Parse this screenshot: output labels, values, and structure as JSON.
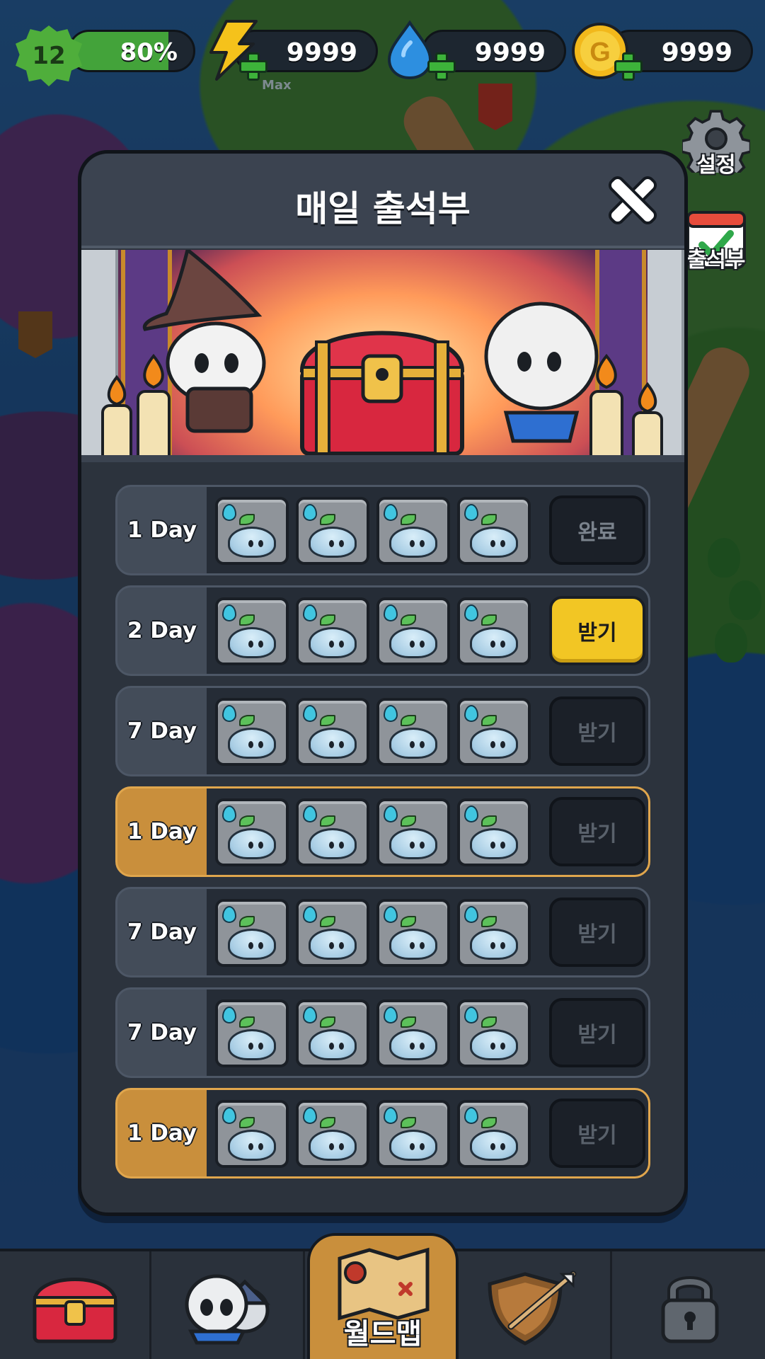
{
  "top_bar": {
    "level": "12",
    "xp_percent_text": "80%",
    "xp_fraction": 0.8,
    "energy": {
      "value": "9999",
      "sub_label": "Max",
      "icon": "lightning-icon"
    },
    "water": {
      "value": "9999",
      "icon": "water-drop-icon"
    },
    "gold": {
      "value": "9999",
      "icon": "gold-coin-icon"
    }
  },
  "side_menu": {
    "settings_label": "설정",
    "attendance_label": "출석부"
  },
  "modal": {
    "title": "매일 출석부",
    "rows": [
      {
        "day": "1 Day",
        "style": "normal",
        "button": "완료",
        "state": "done"
      },
      {
        "day": "2 Day",
        "style": "normal",
        "button": "받기",
        "state": "active"
      },
      {
        "day": "7 Day",
        "style": "normal",
        "button": "받기",
        "state": "locked"
      },
      {
        "day": "1 Day",
        "style": "gold",
        "button": "받기",
        "state": "locked"
      },
      {
        "day": "7 Day",
        "style": "normal",
        "button": "받기",
        "state": "locked"
      },
      {
        "day": "7 Day",
        "style": "normal",
        "button": "받기",
        "state": "locked"
      },
      {
        "day": "1 Day",
        "style": "gold",
        "button": "받기",
        "state": "locked"
      }
    ]
  },
  "bottom_nav": {
    "tabs": [
      {
        "icon": "treasure-chest-icon",
        "label": ""
      },
      {
        "icon": "characters-icon",
        "label": ""
      },
      {
        "icon": "world-map-icon",
        "label": "월드맵"
      },
      {
        "icon": "shield-icon",
        "label": ""
      },
      {
        "icon": "lock-icon",
        "label": ""
      }
    ]
  },
  "colors": {
    "accent_yellow": "#f2c624",
    "gold_row": "#c98f3c",
    "panel": "#2c333d"
  }
}
